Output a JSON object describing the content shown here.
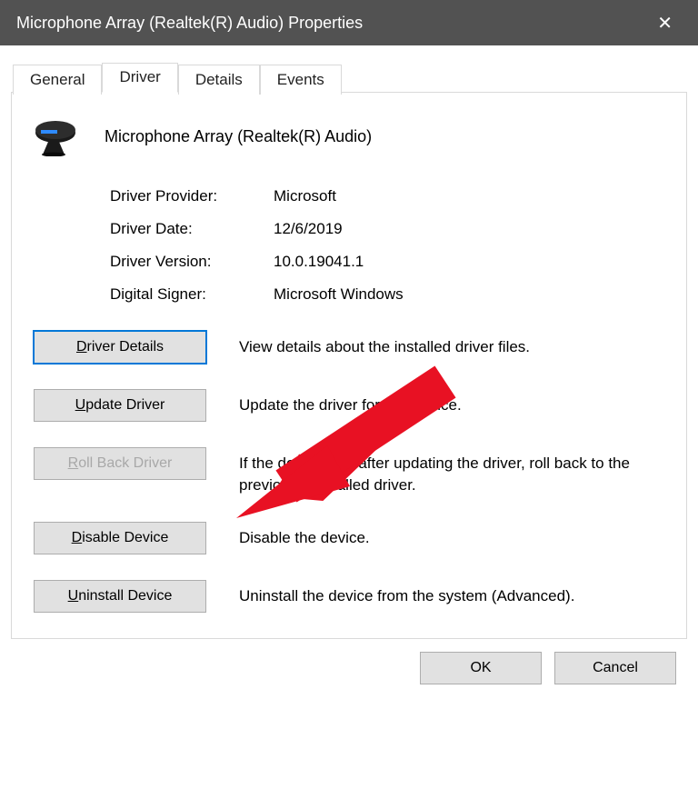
{
  "window": {
    "title": "Microphone Array (Realtek(R) Audio) Properties"
  },
  "tabs": {
    "general": "General",
    "driver": "Driver",
    "details": "Details",
    "events": "Events"
  },
  "device": {
    "name": "Microphone Array (Realtek(R) Audio)"
  },
  "info": {
    "provider_label": "Driver Provider:",
    "provider_value": "Microsoft",
    "date_label": "Driver Date:",
    "date_value": "12/6/2019",
    "version_label": "Driver Version:",
    "version_value": "10.0.19041.1",
    "signer_label": "Digital Signer:",
    "signer_value": "Microsoft Windows"
  },
  "actions": {
    "details_label": "river Details",
    "details_desc": "View details about the installed driver files.",
    "update_label": "pdate Driver",
    "update_desc": "Update the driver for this device.",
    "rollback_label": "oll Back Driver",
    "rollback_desc": "If the device fails after updating the driver, roll back to the previously installed driver.",
    "disable_label": "isable Device",
    "disable_desc": "Disable the device.",
    "uninstall_label": "ninstall Device",
    "uninstall_desc": "Uninstall the device from the system (Advanced)."
  },
  "footer": {
    "ok": "OK",
    "cancel": "Cancel"
  }
}
